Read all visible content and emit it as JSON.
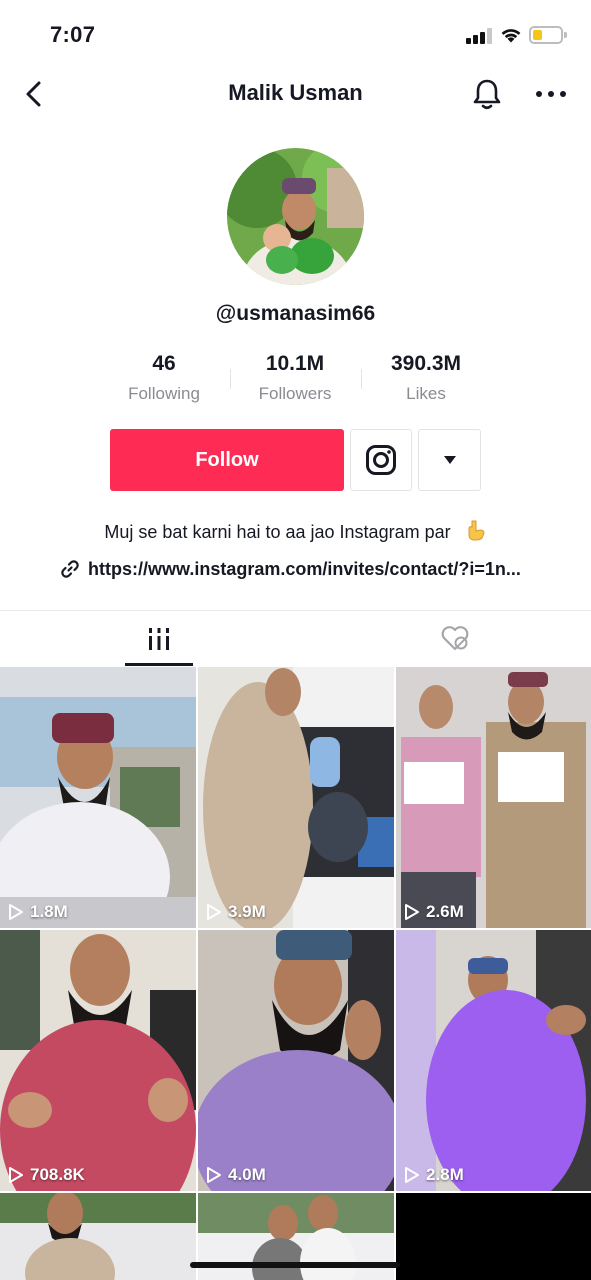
{
  "status_bar": {
    "time": "7:07",
    "battery_color": "#f5c518"
  },
  "header": {
    "title": "Malik Usman"
  },
  "profile": {
    "username": "@usmanasim66",
    "stats": [
      {
        "value": "46",
        "label": "Following"
      },
      {
        "value": "10.1M",
        "label": "Followers"
      },
      {
        "value": "390.3M",
        "label": "Likes"
      }
    ],
    "follow_label": "Follow",
    "bio": "Muj se bat karni hai to aa jao Instagram par",
    "link": "https://www.instagram.com/invites/contact/?i=1n..."
  },
  "colors": {
    "accent": "#fe2c55",
    "text": "#161823",
    "muted": "#8a8b91"
  },
  "tabs": [
    {
      "name": "videos",
      "icon": "grid-icon",
      "active": true
    },
    {
      "name": "liked",
      "icon": "hidden-heart-icon",
      "active": false
    }
  ],
  "videos": [
    {
      "views": "1.8M"
    },
    {
      "views": "3.9M"
    },
    {
      "views": "2.6M"
    },
    {
      "views": "708.8K"
    },
    {
      "views": "4.0M"
    },
    {
      "views": "2.8M"
    },
    {
      "views": ""
    },
    {
      "views": ""
    }
  ]
}
